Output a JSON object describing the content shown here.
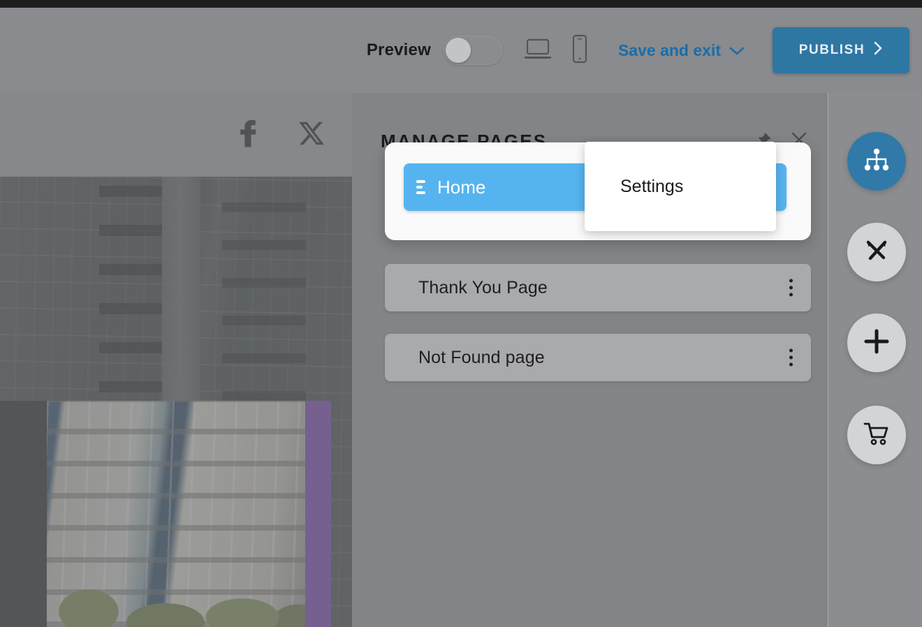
{
  "toolbar": {
    "preview_label": "Preview",
    "preview_toggle_state": "off",
    "desktop_icon": "laptop-icon",
    "mobile_icon": "mobile-icon",
    "save_and_exit_label": "Save and exit",
    "save_and_exit_chevron": "chevron-down-icon",
    "publish_label": "PUBLISH",
    "publish_chevron": "chevron-right-icon",
    "publish_color": "#2e77a3",
    "link_color": "#1b6ca8"
  },
  "site_preview": {
    "social_icons": [
      {
        "name": "facebook-icon",
        "glyph": "f"
      },
      {
        "name": "x-twitter-icon",
        "glyph": "X"
      }
    ],
    "accent_bar_color": "#6b2fa6"
  },
  "panel": {
    "title": "MANAGE PAGES",
    "pin_icon": "pin-icon",
    "close_icon": "close-icon",
    "active_row_color": "#55b4ef",
    "pages": [
      {
        "label": "Home",
        "active": true,
        "drag_handle": "drag-handle-icon",
        "menu_icon": "kebab-menu-icon"
      },
      {
        "label": "Thank You Page",
        "active": false,
        "menu_icon": "kebab-menu-icon"
      },
      {
        "label": "Not Found page",
        "active": false,
        "menu_icon": "kebab-menu-icon"
      }
    ],
    "context_menu": {
      "items": [
        {
          "label": "Settings"
        }
      ]
    }
  },
  "right_rail": {
    "buttons": [
      {
        "name": "sitemap-icon",
        "label": "Pages",
        "active": true
      },
      {
        "name": "design-tools-icon",
        "label": "Design",
        "active": false
      },
      {
        "name": "plus-icon",
        "label": "Add",
        "active": false
      },
      {
        "name": "shopping-cart-icon",
        "label": "Store",
        "active": false
      }
    ],
    "active_color": "#3079a8",
    "inactive_color": "#d3d4d5"
  }
}
